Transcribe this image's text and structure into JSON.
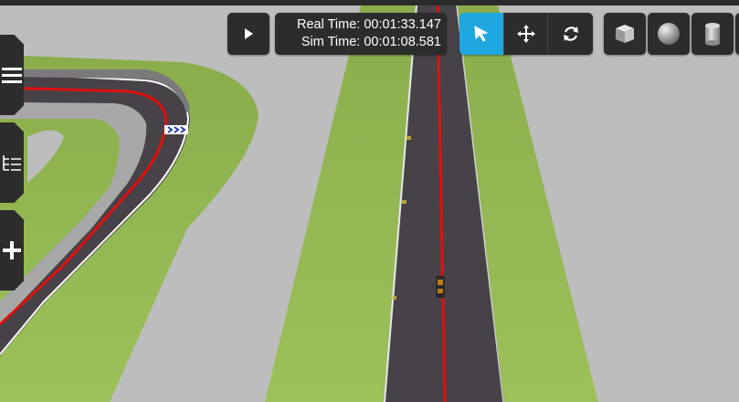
{
  "toolbar": {
    "real_time_label": "Real Time: 00:01:33.147",
    "sim_time_label": "Sim Time: 00:01:08.581"
  },
  "icons": {
    "play": "play-icon",
    "select": "arrow-icon",
    "translate": "move-arrows-icon",
    "rotate": "rotate-icon",
    "box": "cube-icon",
    "sphere": "sphere-icon",
    "cylinder": "cylinder-icon",
    "menu": "hamburger-icon",
    "tree": "tree-icon",
    "insert": "plus-icon"
  },
  "colors": {
    "toolbar_bg": "#2c2c2c",
    "active_mode": "#1fa7e0",
    "grass": "#8fb04f",
    "ground": "#bdbdbd",
    "asphalt": "#474247",
    "center_line": "#e01010"
  },
  "scene": {
    "active_tool": "select"
  }
}
